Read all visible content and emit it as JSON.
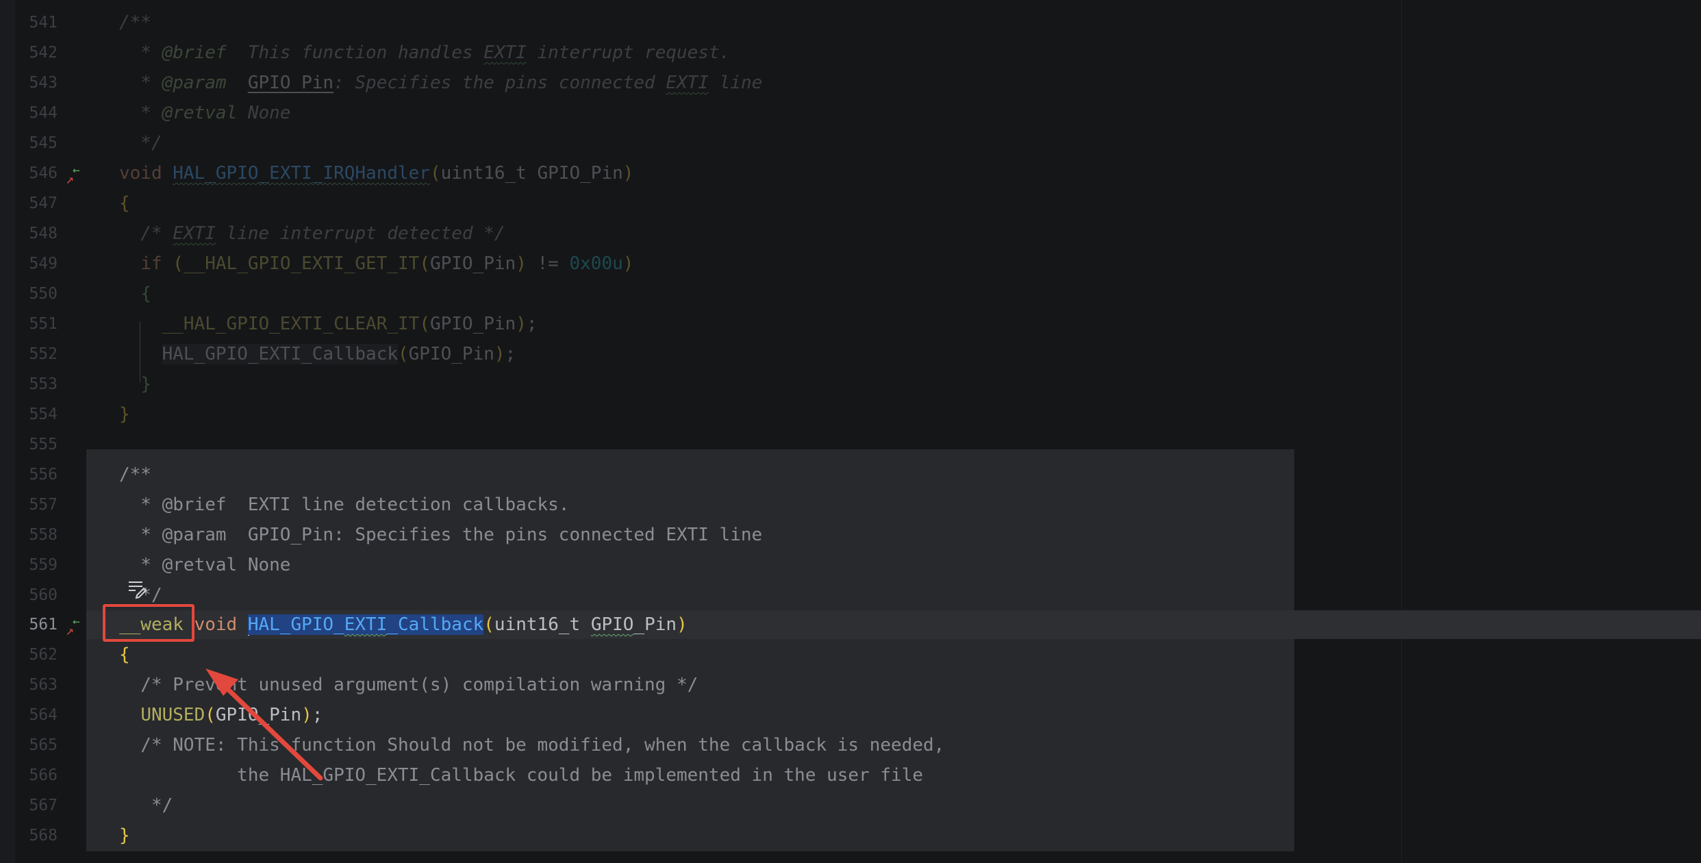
{
  "editor": {
    "lines": [
      {
        "n": "541",
        "t": "/**"
      },
      {
        "n": "542",
        "t": "  * @brief  This function handles EXTI interrupt request."
      },
      {
        "n": "543",
        "t": "  * @param  GPIO_Pin: Specifies the pins connected EXTI line"
      },
      {
        "n": "544",
        "t": "  * @retval None"
      },
      {
        "n": "545",
        "t": "  */"
      },
      {
        "n": "546",
        "t": "void HAL_GPIO_EXTI_IRQHandler(uint16_t GPIO_Pin)"
      },
      {
        "n": "547",
        "t": "{"
      },
      {
        "n": "548",
        "t": "  /* EXTI line interrupt detected */"
      },
      {
        "n": "549",
        "t": "  if (__HAL_GPIO_EXTI_GET_IT(GPIO_Pin) != 0x00u)"
      },
      {
        "n": "550",
        "t": "  {"
      },
      {
        "n": "551",
        "t": "    __HAL_GPIO_EXTI_CLEAR_IT(GPIO_Pin);"
      },
      {
        "n": "552",
        "t": "    HAL_GPIO_EXTI_Callback(GPIO_Pin);"
      },
      {
        "n": "553",
        "t": "  }"
      },
      {
        "n": "554",
        "t": "}"
      },
      {
        "n": "555",
        "t": ""
      },
      {
        "n": "556",
        "t": "/**"
      },
      {
        "n": "557",
        "t": "  * @brief  EXTI line detection callbacks."
      },
      {
        "n": "558",
        "t": "  * @param  GPIO_Pin: Specifies the pins connected EXTI line"
      },
      {
        "n": "559",
        "t": "  * @retval None"
      },
      {
        "n": "560",
        "t": "  */"
      },
      {
        "n": "561",
        "t": "__weak void HAL_GPIO_EXTI_Callback(uint16_t GPIO_Pin)"
      },
      {
        "n": "562",
        "t": "{"
      },
      {
        "n": "563",
        "t": "  /* Prevent unused argument(s) compilation warning */"
      },
      {
        "n": "564",
        "t": "  UNUSED(GPIO_Pin);"
      },
      {
        "n": "565",
        "t": "  /* NOTE: This function Should not be modified, when the callback is needed,"
      },
      {
        "n": "566",
        "t": "           the HAL_GPIO_EXTI_Callback could be implemented in the user file"
      },
      {
        "n": "567",
        "t": "   */"
      },
      {
        "n": "568",
        "t": "}"
      }
    ],
    "current_line": "561",
    "annotation_color": "#e2483d"
  }
}
